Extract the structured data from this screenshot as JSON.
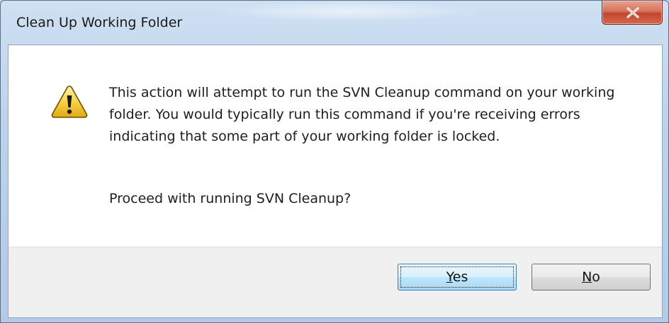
{
  "window": {
    "title": "Clean Up Working Folder",
    "close_glyph": "X"
  },
  "dialog": {
    "icon": "warning-icon",
    "message": "This action will attempt to run the SVN Cleanup command on your working folder. You would typically run this command if you're receiving errors indicating that some part of your working folder is locked.",
    "question": "Proceed with running SVN Cleanup?"
  },
  "buttons": {
    "yes_accel": "Y",
    "yes_rest": "es",
    "no_accel": "N",
    "no_rest": "o"
  },
  "colors": {
    "warning_fill": "#f7d24a",
    "warning_stroke": "#6b5200",
    "close_button": "#c2452d"
  }
}
